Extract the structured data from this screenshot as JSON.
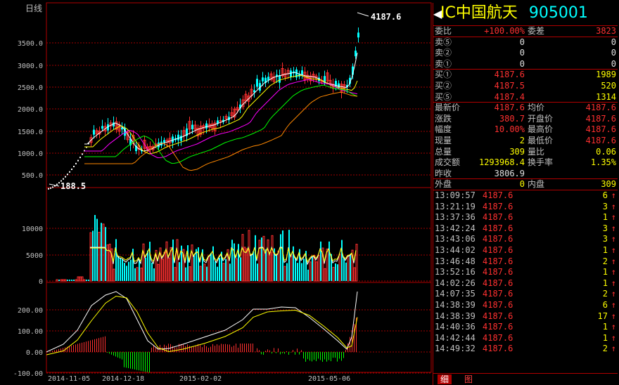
{
  "chart": {
    "period_label": "日线",
    "price_axis": [
      "3500.0",
      "3000.0",
      "2500.0",
      "2000.0",
      "1500.0",
      "1000.0",
      "500.0"
    ],
    "volume_axis": [
      "10000",
      "5000",
      "0"
    ],
    "macd_axis": [
      "200.00",
      "100.00",
      "0.00",
      "-100.00"
    ],
    "date_axis": [
      "2014-11-05",
      "2014-12-18",
      "2015-02-02",
      "2015-05-06"
    ],
    "high_label": "4187.6",
    "low_label": "188.5"
  },
  "chart_data": {
    "type": "line",
    "series": [
      {
        "x": [
          "2014-11-05",
          "2014-11-20",
          "2014-12-05",
          "2014-12-18",
          "2015-01-10",
          "2015-02-02",
          "2015-03-01",
          "2015-03-25",
          "2015-04-15",
          "2015-05-06",
          "2015-05-20",
          "2015-06-01"
        ],
        "values": [
          188.5,
          1250,
          1450,
          1000,
          1150,
          1350,
          1650,
          2350,
          2700,
          2550,
          2600,
          4187.6
        ]
      },
      {
        "x": [
          "2014-11-05",
          "2014-11-20",
          "2014-12-05",
          "2014-12-18",
          "2015-01-10",
          "2015-02-02",
          "2015-03-01",
          "2015-03-25",
          "2015-04-15",
          "2015-05-06",
          "2015-05-20",
          "2015-06-01"
        ],
        "values": [
          0,
          0,
          12000,
          6000,
          4000,
          3000,
          5000,
          6000,
          5500,
          4000,
          3000,
          5500
        ]
      },
      {
        "x": [
          "2014-11-05",
          "2014-11-20",
          "2014-12-05",
          "2014-12-18",
          "2015-01-10",
          "2015-02-02",
          "2015-03-01",
          "2015-03-25",
          "2015-04-15",
          "2015-05-06",
          "2015-05-20",
          "2015-06-01"
        ],
        "values": [
          0,
          60,
          200,
          230,
          60,
          0,
          30,
          120,
          200,
          170,
          20,
          270
        ]
      }
    ],
    "ylim": [
      [
        200,
        3800
      ],
      [
        0,
        16000
      ],
      [
        -100,
        280
      ]
    ]
  },
  "side": {
    "title": "IC中国航天",
    "code": "905001",
    "weibi": {
      "label": "委比",
      "value": "+100.00%",
      "label2": "委差",
      "value2": "3823"
    },
    "asks": [
      {
        "label": "卖⑤",
        "price": "0",
        "vol": "0"
      },
      {
        "label": "卖②",
        "price": "0",
        "vol": "0"
      },
      {
        "label": "卖①",
        "price": "0",
        "vol": "0"
      }
    ],
    "bids": [
      {
        "label": "买①",
        "price": "4187.6",
        "vol": "1989"
      },
      {
        "label": "买②",
        "price": "4187.5",
        "vol": "520"
      },
      {
        "label": "买⑤",
        "price": "4187.4",
        "vol": "1314"
      }
    ],
    "quote": [
      {
        "l1": "最新价",
        "v1": "4187.6",
        "l2": "均价",
        "v2": "4187.6"
      },
      {
        "l1": "涨跌",
        "v1": "380.7",
        "l2": "开盘价",
        "v2": "4187.6"
      },
      {
        "l1": "幅度",
        "v1": "10.00%",
        "l2": "最高价",
        "v2": "4187.6"
      },
      {
        "l1": "现量",
        "v1": "2",
        "l2": "最低价",
        "v2": "4187.6"
      },
      {
        "l1": "总量",
        "v1": "309",
        "l2": "量比",
        "v2": "0.06"
      },
      {
        "l1": "成交额",
        "v1": "1293968.4",
        "l2": "换手率",
        "v2": "1.35%"
      }
    ],
    "prev_close": {
      "label": "昨收",
      "value": "3806.9"
    },
    "outer": {
      "label": "外盘",
      "value": "0",
      "label2": "内盘",
      "value2": "309"
    },
    "ticks": [
      {
        "time": "13:09:57",
        "price": "4187.6",
        "vol": "6"
      },
      {
        "time": "13:21:19",
        "price": "4187.6",
        "vol": "3"
      },
      {
        "time": "13:37:36",
        "price": "4187.6",
        "vol": "1"
      },
      {
        "time": "13:42:24",
        "price": "4187.6",
        "vol": "3"
      },
      {
        "time": "13:43:06",
        "price": "4187.6",
        "vol": "3"
      },
      {
        "time": "13:44:02",
        "price": "4187.6",
        "vol": "1"
      },
      {
        "time": "13:46:48",
        "price": "4187.6",
        "vol": "2"
      },
      {
        "time": "13:52:16",
        "price": "4187.6",
        "vol": "1"
      },
      {
        "time": "14:02:26",
        "price": "4187.6",
        "vol": "1"
      },
      {
        "time": "14:07:35",
        "price": "4187.6",
        "vol": "2"
      },
      {
        "time": "14:38:39",
        "price": "4187.6",
        "vol": "6"
      },
      {
        "time": "14:38:39",
        "price": "4187.6",
        "vol": "17"
      },
      {
        "time": "14:40:36",
        "price": "4187.6",
        "vol": "1"
      },
      {
        "time": "14:42:44",
        "price": "4187.6",
        "vol": "1"
      },
      {
        "time": "14:49:32",
        "price": "4187.6",
        "vol": "2"
      }
    ],
    "up_arrow": "↑",
    "tabs": [
      "细",
      "图"
    ]
  }
}
